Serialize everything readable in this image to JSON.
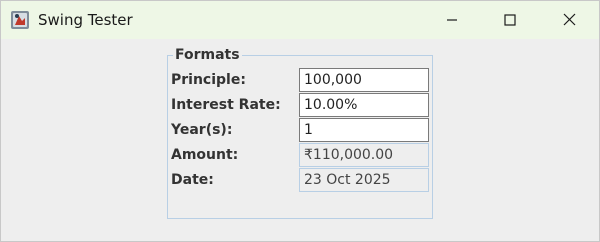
{
  "window": {
    "title": "Swing Tester",
    "controls": {
      "minimize": "minimize",
      "maximize": "maximize",
      "close": "close"
    }
  },
  "formats": {
    "legend": "Formats",
    "rows": [
      {
        "label": "Principle:",
        "value": "100,000",
        "editable": true
      },
      {
        "label": "Interest Rate:",
        "value": "10.00%",
        "editable": true
      },
      {
        "label": "Year(s):",
        "value": "1",
        "editable": true
      },
      {
        "label": "Amount:",
        "value": "₹110,000.00",
        "editable": false
      },
      {
        "label": "Date:",
        "value": "23 Oct 2025",
        "editable": false
      }
    ]
  },
  "colors": {
    "titlebar": "#eef7e6",
    "window_bg": "#eeeeee",
    "group_border": "#b8cfe5",
    "field_border": "#7a7a7a"
  },
  "icons": {
    "app": "java-app-icon",
    "minimize": "minimize-icon",
    "maximize": "maximize-icon",
    "close": "close-icon"
  }
}
